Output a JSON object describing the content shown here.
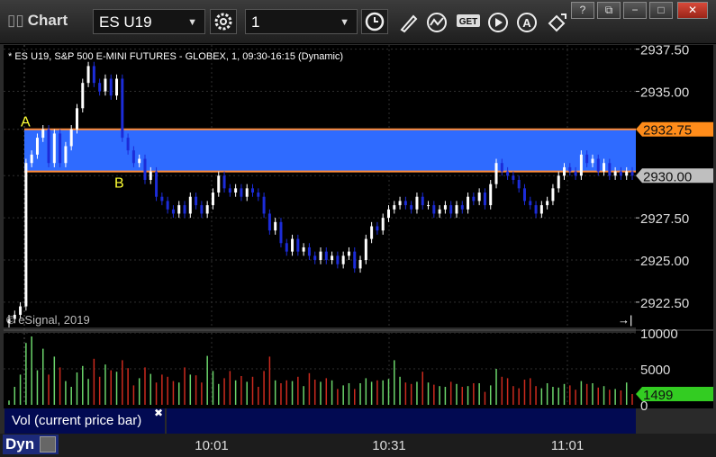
{
  "window": {
    "title": "Chart",
    "symbol": "ES U19",
    "interval": "1",
    "buttons": [
      "−",
      "□",
      "✕"
    ]
  },
  "chart_data": {
    "type": "candlestick",
    "title": "* ES U19, S&P 500 E-MINI FUTURES - GLOBEX, 1, 09:30-16:15 (Dynamic)",
    "copyright": "© eSignal, 2019",
    "ylim": [
      2921.0,
      2937.75
    ],
    "yticks": [
      "2937.50",
      "2935.00",
      "2932.75",
      "2930.00",
      "2927.50",
      "2925.00",
      "2922.50"
    ],
    "x_time_labels": [
      "10:01",
      "10:31",
      "11:01"
    ],
    "zone": {
      "upper": 2932.75,
      "lower": 2930.25,
      "color": "#2f6bff"
    },
    "zone_marks": [
      {
        "label": "A",
        "price": 2932.75
      },
      {
        "label": "B",
        "price": 2930.25
      }
    ],
    "price_flags": [
      {
        "text": "2932.75",
        "value": 2932.75,
        "bg": "#ff8c1a"
      },
      {
        "text": "2930.00",
        "value": 2930.0,
        "bg": "#bfbfbf"
      }
    ],
    "closes": [
      2921.5,
      2921.75,
      2922.25,
      2930.75,
      2931.25,
      2932.25,
      2932.75,
      2930.75,
      2932.5,
      2930.75,
      2931.75,
      2932.75,
      2934.0,
      2935.5,
      2936.5,
      2935.5,
      2935.0,
      2935.75,
      2934.75,
      2935.75,
      2932.25,
      2931.5,
      2930.75,
      2931.0,
      2929.75,
      2930.25,
      2928.75,
      2928.5,
      2928.0,
      2927.75,
      2928.25,
      2927.75,
      2928.75,
      2928.25,
      2927.75,
      2928.25,
      2929.0,
      2930.0,
      2929.25,
      2929.0,
      2929.25,
      2928.75,
      2929.25,
      2929.0,
      2928.75,
      2927.75,
      2926.75,
      2927.25,
      2926.0,
      2925.5,
      2926.25,
      2925.5,
      2925.75,
      2925.25,
      2925.0,
      2925.5,
      2925.0,
      2925.25,
      2924.75,
      2925.25,
      2925.5,
      2924.5,
      2925.0,
      2926.25,
      2927.0,
      2926.75,
      2927.5,
      2928.0,
      2928.25,
      2928.5,
      2928.25,
      2928.0,
      2928.75,
      2928.25,
      2928.25,
      2927.75,
      2928.0,
      2928.25,
      2927.75,
      2928.25,
      2928.0,
      2928.75,
      2928.5,
      2929.0,
      2928.25,
      2929.5,
      2930.75,
      2930.25,
      2930.0,
      2929.75,
      2929.25,
      2928.5,
      2928.25,
      2927.75,
      2928.25,
      2928.5,
      2929.25,
      2930.0,
      2930.5,
      2930.25,
      2930.0,
      2931.25,
      2930.75,
      2931.0,
      2930.25,
      2930.75,
      2930.0,
      2930.25,
      2930.0,
      2930.25,
      2930.0
    ],
    "volume_ylim": [
      0,
      10000
    ],
    "volume_ticks": [
      "10000",
      "5000",
      "0"
    ],
    "volume_last": "1499",
    "volume_legend": "Vol (current price bar)",
    "volumes": [
      600,
      2500,
      4200,
      8600,
      9500,
      4800,
      7800,
      4200,
      6700,
      5200,
      3300,
      2500,
      4500,
      5400,
      3600,
      6400,
      3900,
      5600,
      4800,
      4600,
      6200,
      5100,
      2700,
      3700,
      5200,
      4300,
      3100,
      4200,
      3900,
      3300,
      3100,
      5200,
      4200,
      4100,
      3100,
      6800,
      4700,
      2900,
      3700,
      4700,
      3400,
      4000,
      3200,
      3900,
      2500,
      4700,
      6700,
      3400,
      3000,
      3400,
      3300,
      3900,
      2600,
      4400,
      3500,
      3200,
      3700,
      3400,
      2200,
      2700,
      3000,
      2200,
      3000,
      3700,
      3200,
      3400,
      3400,
      3600,
      6200,
      3900,
      3100,
      2900,
      3200,
      4600,
      3100,
      2800,
      2600,
      2500,
      3200,
      2900,
      2500,
      2600,
      3000,
      3000,
      1800,
      2700,
      5000,
      3900,
      3700,
      2600,
      2300,
      3500,
      3700,
      2600,
      2300,
      3000,
      2500,
      2400,
      2900,
      2700,
      2100,
      3300,
      2900,
      3000,
      2400,
      2600,
      2100,
      2200,
      2000,
      3100,
      1499
    ]
  },
  "footer": {
    "dyn_label": "Dyn",
    "colors": {
      "up": "#ffffff",
      "down": "#1c2cd8",
      "vol_up": "#6bd56b",
      "vol_down": "#cc2a1e",
      "grid": "#2f2f2f",
      "zone_line": "#ff8c3a",
      "labels": "#ffff33"
    }
  }
}
